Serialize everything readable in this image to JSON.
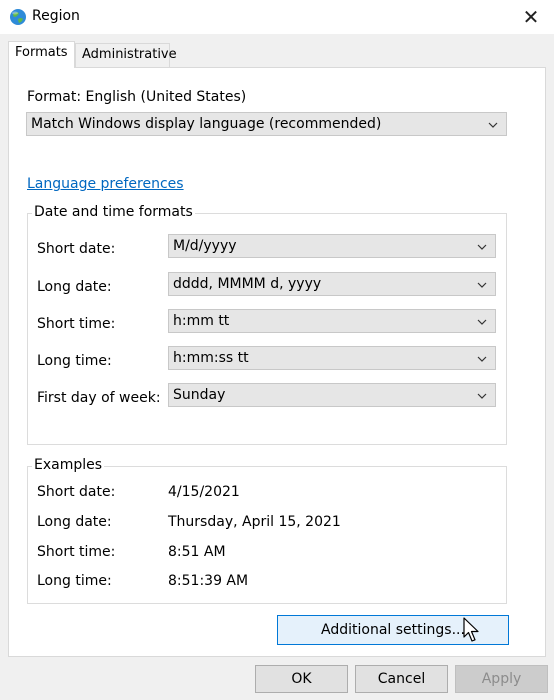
{
  "window": {
    "title": "Region",
    "icon": "globe-icon",
    "close_glyph": "✕"
  },
  "tabs": [
    {
      "label": "Formats",
      "active": true
    },
    {
      "label": "Administrative",
      "active": false
    }
  ],
  "format": {
    "label": "Format: English (United States)",
    "selected": "Match Windows display language (recommended)"
  },
  "language_link": "Language preferences",
  "date_time": {
    "legend": "Date and time formats",
    "rows": [
      {
        "label": "Short date:",
        "value": "M/d/yyyy"
      },
      {
        "label": "Long date:",
        "value": "dddd, MMMM d, yyyy"
      },
      {
        "label": "Short time:",
        "value": "h:mm tt"
      },
      {
        "label": "Long time:",
        "value": "h:mm:ss tt"
      },
      {
        "label": "First day of week:",
        "value": "Sunday"
      }
    ]
  },
  "examples": {
    "legend": "Examples",
    "rows": [
      {
        "label": "Short date:",
        "value": "4/15/2021"
      },
      {
        "label": "Long date:",
        "value": "Thursday, April 15, 2021"
      },
      {
        "label": "Short time:",
        "value": "8:51 AM"
      },
      {
        "label": "Long time:",
        "value": "8:51:39 AM"
      }
    ]
  },
  "buttons": {
    "additional": "Additional settings...",
    "ok": "OK",
    "cancel": "Cancel",
    "apply": "Apply"
  },
  "colors": {
    "link": "#0067c0",
    "hover_border": "#0078d7"
  }
}
